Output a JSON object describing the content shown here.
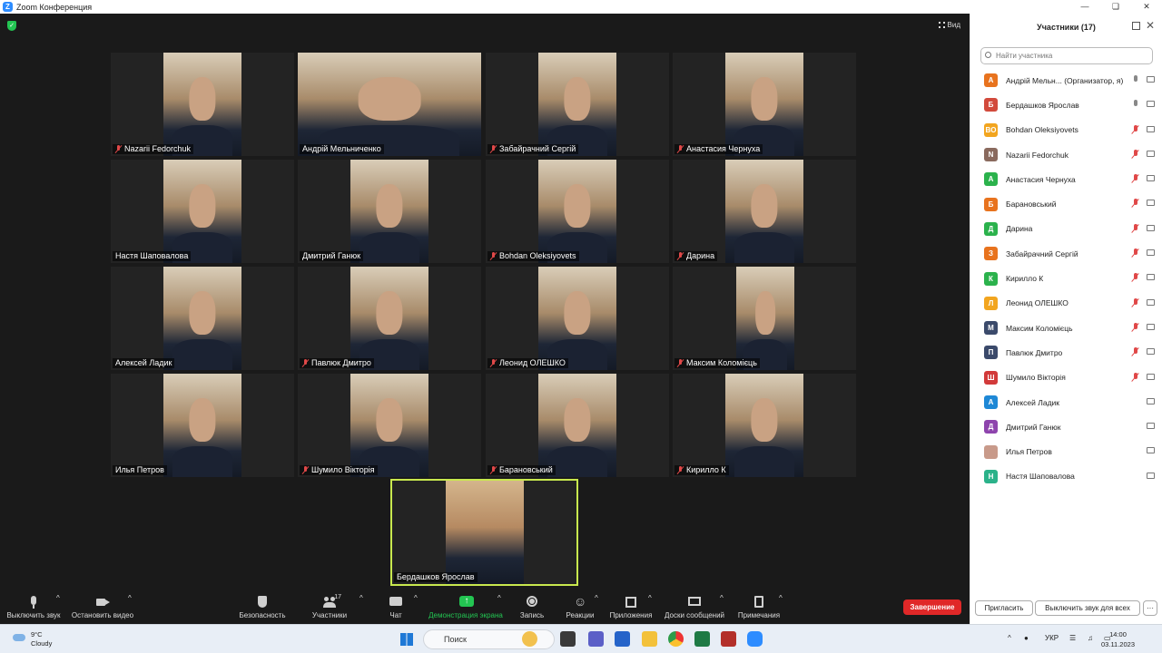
{
  "window": {
    "title": "Zoom Конференция"
  },
  "stage": {
    "view_label": "Вид",
    "tiles": [
      {
        "name": "Nazarii Fedorchuk",
        "muted": true
      },
      {
        "name": "Андрій Мельниченко",
        "muted": false
      },
      {
        "name": "Забайрачний Сергій",
        "muted": true
      },
      {
        "name": "Анастасия Чернуха",
        "muted": true
      },
      {
        "name": "Настя Шаповалова",
        "muted": false
      },
      {
        "name": "Дмитрий Ганюк",
        "muted": false
      },
      {
        "name": "Bohdan Oleksiyovets",
        "muted": true
      },
      {
        "name": "Дарина",
        "muted": true
      },
      {
        "name": "Алексей Ладик",
        "muted": false
      },
      {
        "name": "Павлюк Дмитро",
        "muted": true
      },
      {
        "name": "Леонид ОЛЕШКО",
        "muted": true
      },
      {
        "name": "Максим Коломієць",
        "muted": true
      },
      {
        "name": "Илья Петров",
        "muted": false
      },
      {
        "name": "Шумило Вікторія",
        "muted": true
      },
      {
        "name": "Барановський",
        "muted": true
      },
      {
        "name": "Кирилло К",
        "muted": true
      }
    ],
    "active_speaker": {
      "name": "Бердашков Ярослав",
      "muted": false
    }
  },
  "toolbar": {
    "mute": "Выключить звук",
    "video": "Остановить видео",
    "security": "Безопасность",
    "participants": "Участники",
    "participants_count": "17",
    "chat": "Чат",
    "share": "Демонстрация экрана",
    "record": "Запись",
    "reactions": "Реакции",
    "apps": "Приложения",
    "whiteboards": "Доски сообщений",
    "notes": "Примечания",
    "end": "Завершение"
  },
  "panel": {
    "title": "Участники (17)",
    "search_placeholder": "Найти участника",
    "participants": [
      {
        "initial": "А",
        "name": "Андрій Мельн...  (Организатор, я)",
        "color": "#e8731e",
        "mic": "on"
      },
      {
        "initial": "Б",
        "name": "Бердашков Ярослав",
        "color": "#d24a3c",
        "mic": "on"
      },
      {
        "initial": "BO",
        "name": "Bohdan Oleksiyovets",
        "color": "#f2a51f",
        "mic": "off"
      },
      {
        "initial": "N",
        "name": "Nazarii Fedorchuk",
        "color": "#8a6a5e",
        "mic": "off"
      },
      {
        "initial": "А",
        "name": "Анастасия Чернуха",
        "color": "#2bb24c",
        "mic": "off"
      },
      {
        "initial": "Б",
        "name": "Барановський",
        "color": "#e8731e",
        "mic": "off"
      },
      {
        "initial": "Д",
        "name": "Дарина",
        "color": "#2bb24c",
        "mic": "off"
      },
      {
        "initial": "З",
        "name": "Забайрачний Сергій",
        "color": "#e8731e",
        "mic": "off"
      },
      {
        "initial": "К",
        "name": "Кирилло К",
        "color": "#2bb24c",
        "mic": "off"
      },
      {
        "initial": "Л",
        "name": "Леонид ОЛЕШКО",
        "color": "#f2a51f",
        "mic": "off"
      },
      {
        "initial": "М",
        "name": "Максим Коломієць",
        "color": "#3b4a6b",
        "mic": "off"
      },
      {
        "initial": "П",
        "name": "Павлюк Дмитро",
        "color": "#3b4a6b",
        "mic": "off"
      },
      {
        "initial": "Ш",
        "name": "Шумило Вікторія",
        "color": "#d23a3a",
        "mic": "off"
      },
      {
        "initial": "А",
        "name": "Алексей Ладик",
        "color": "#1e88d6",
        "mic": "none"
      },
      {
        "initial": "Д",
        "name": "Дмитрий Ганюк",
        "color": "#8e44ad",
        "mic": "none"
      },
      {
        "initial": "",
        "name": "Илья Петров",
        "color": "#c89a8a",
        "mic": "none"
      },
      {
        "initial": "Н",
        "name": "Настя Шаповалова",
        "color": "#2bb28a",
        "mic": "none"
      }
    ],
    "invite": "Пригласить",
    "mute_all": "Выключить звук для всех",
    "more": "···"
  },
  "taskbar": {
    "temp": "9°C",
    "weather": "Cloudy",
    "search": "Поиск",
    "lang": "УКР",
    "time": "14:00",
    "date": "03.11.2023"
  }
}
